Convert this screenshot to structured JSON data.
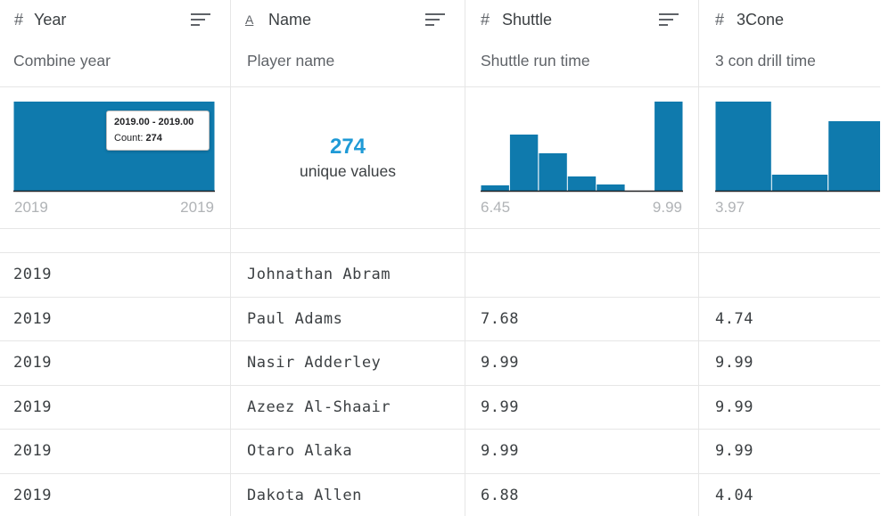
{
  "columns": [
    {
      "type_icon": "#",
      "type_icon_name": "number-icon",
      "title": "Year",
      "description": "Combine year",
      "axis_min": "2019",
      "axis_max": "2019",
      "histogram": {
        "bins": [
          1
        ],
        "bin_range": [
          2019,
          2019
        ]
      }
    },
    {
      "type_icon": "A",
      "type_icon_name": "string-icon",
      "title": "Name",
      "description": "Player name",
      "unique_count": "274",
      "unique_label": "unique values"
    },
    {
      "type_icon": "#",
      "type_icon_name": "number-icon",
      "title": "Shuttle",
      "description": "Shuttle run time",
      "axis_min": "6.45",
      "axis_max": "9.99",
      "histogram": {
        "bins": [
          0.06,
          0.63,
          0.42,
          0.16,
          0.07,
          0,
          1.0
        ]
      }
    },
    {
      "type_icon": "#",
      "type_icon_name": "number-icon",
      "title": "3Cone",
      "description": "3 con drill time",
      "axis_min": "3.97",
      "histogram": {
        "bins": [
          1.0,
          0.18,
          0.78
        ]
      }
    }
  ],
  "tooltip": {
    "range": "2019.00 - 2019.00",
    "count_label": "Count:",
    "count_value": "274"
  },
  "rows": [
    [
      "2019",
      "Johnathan Abram",
      "",
      ""
    ],
    [
      "2019",
      "Paul Adams",
      "7.68",
      "4.74"
    ],
    [
      "2019",
      "Nasir Adderley",
      "9.99",
      "9.99"
    ],
    [
      "2019",
      "Azeez Al-Shaair",
      "9.99",
      "9.99"
    ],
    [
      "2019",
      "Otaro Alaka",
      "9.99",
      "9.99"
    ],
    [
      "2019",
      "Dakota Allen",
      "6.88",
      "4.04"
    ]
  ],
  "colors": {
    "bar": "#0f7aad",
    "accent": "#1f9ad6",
    "border": "#e6e6e6"
  }
}
